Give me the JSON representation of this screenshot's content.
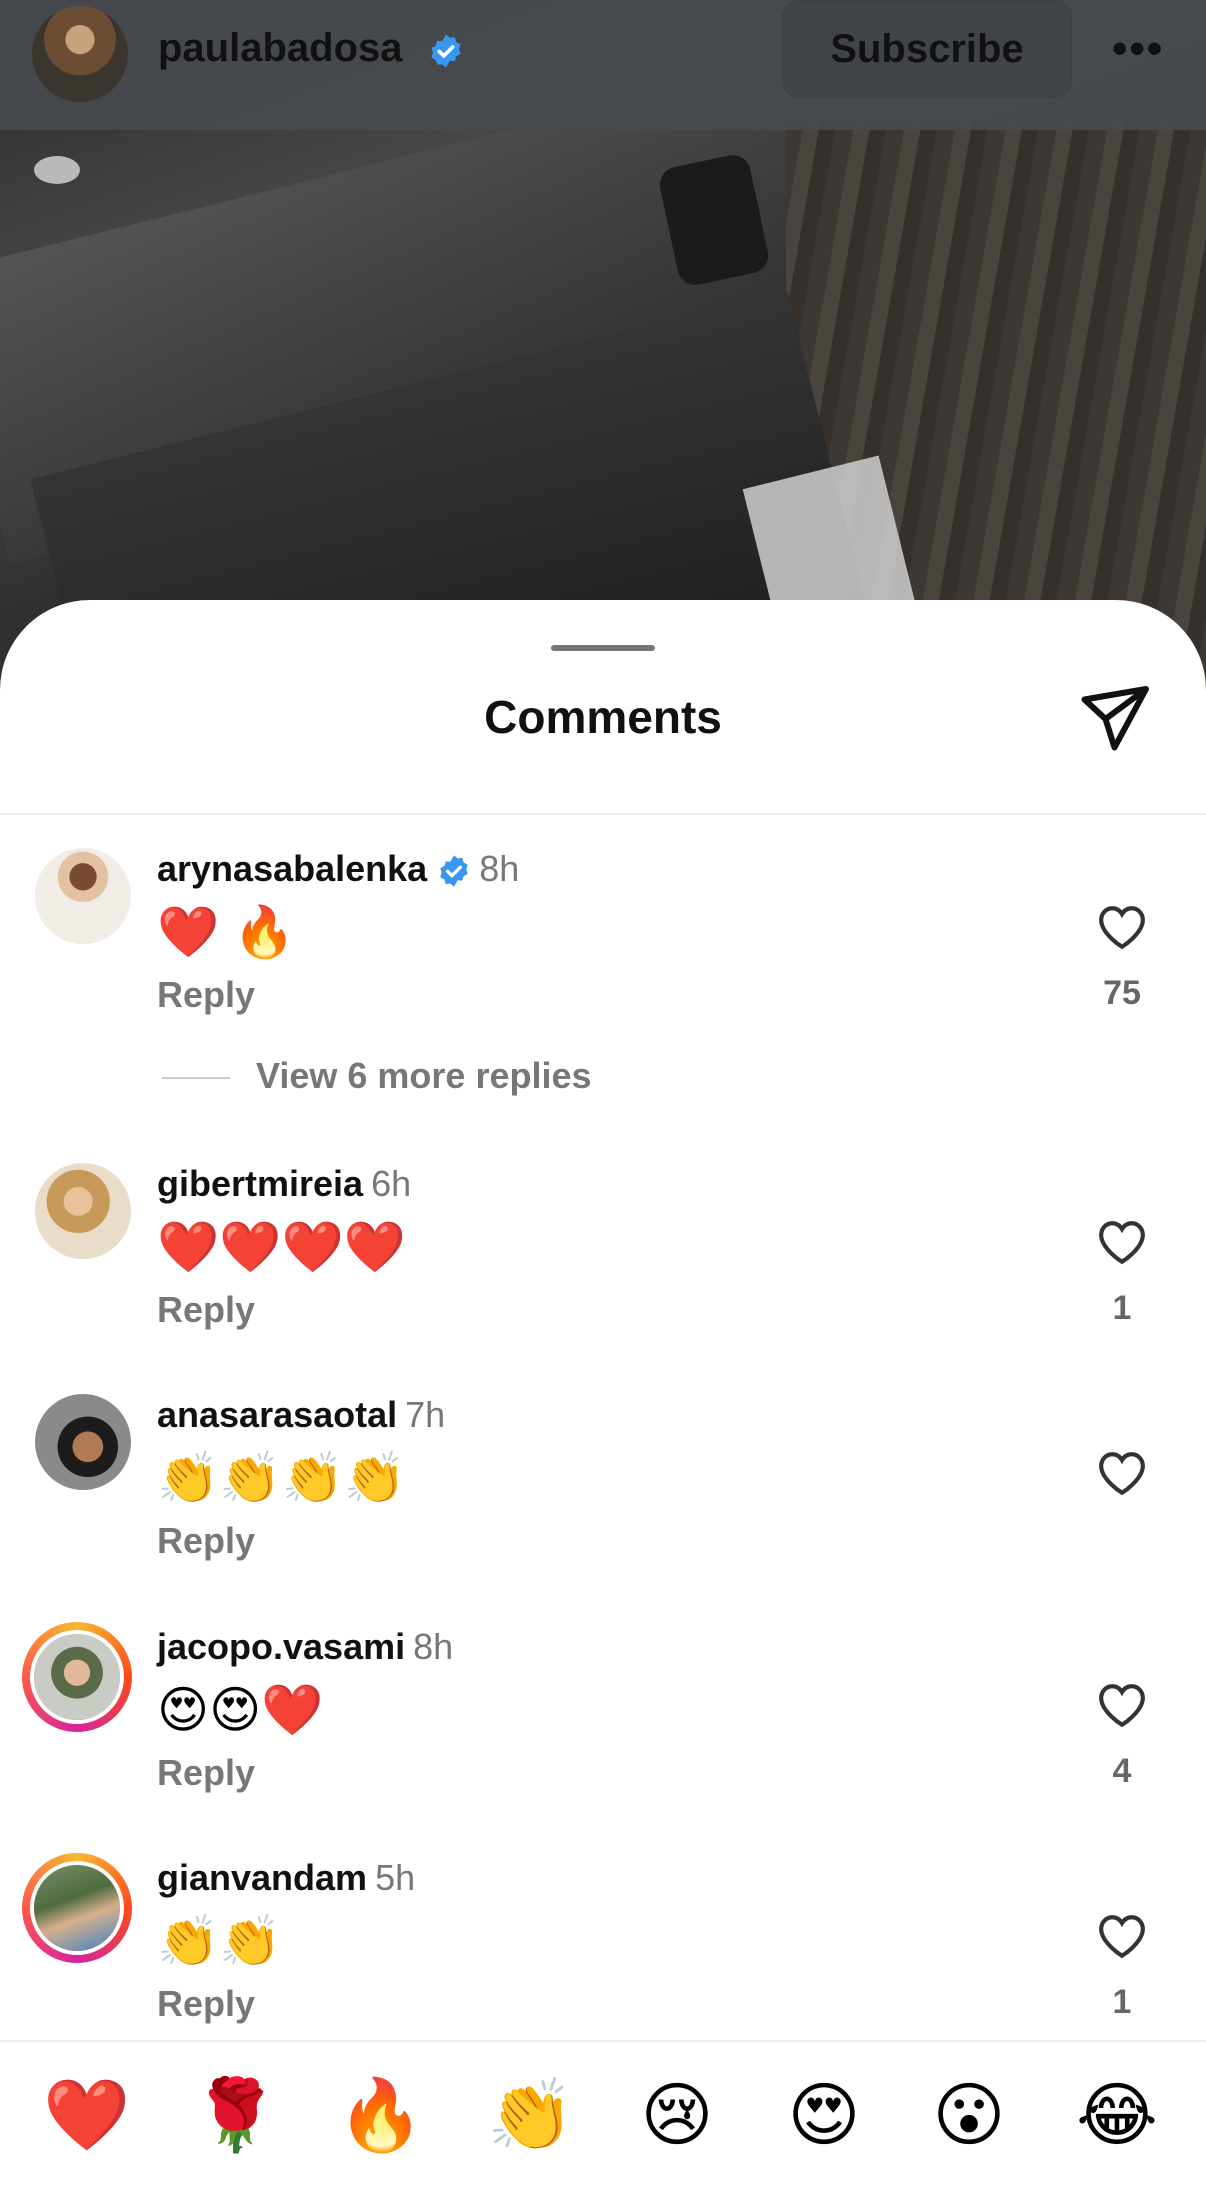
{
  "post": {
    "username": "paulabadosa",
    "subscribe_label": "Subscribe",
    "more_label": "•••"
  },
  "sheet": {
    "title": "Comments"
  },
  "comments": [
    {
      "username": "arynasabalenka",
      "verified": true,
      "time": "8h",
      "text": "❤️ 🔥",
      "reply_label": "Reply",
      "like_count": "75"
    },
    {
      "username": "gibertmireia",
      "verified": false,
      "time": "6h",
      "text": "❤️❤️❤️❤️",
      "reply_label": "Reply",
      "like_count": "1"
    },
    {
      "username": "anasarasaotal",
      "verified": false,
      "time": "7h",
      "text": "👏👏👏👏",
      "reply_label": "Reply",
      "like_count": ""
    },
    {
      "username": "jacopo.vasami",
      "verified": false,
      "time": "8h",
      "text": "😍😍❤️",
      "reply_label": "Reply",
      "like_count": "4"
    },
    {
      "username": "gianvandam",
      "verified": false,
      "time": "5h",
      "text": "👏👏",
      "reply_label": "Reply",
      "like_count": "1"
    }
  ],
  "view_replies_label": "View 6 more replies",
  "emoji_bar": [
    "❤️",
    "🌹",
    "🔥",
    "👏",
    "😢",
    "😍",
    "😮",
    "😂"
  ],
  "colors": {
    "verified": "#3897f0",
    "muted_text": "#777777",
    "story_ring": [
      "#f7b733",
      "#fc4a1a",
      "#d6249f"
    ]
  },
  "icons": {
    "verified": "verified-badge-icon",
    "share": "paper-plane-icon",
    "like": "heart-outline-icon",
    "more": "more-options-icon"
  }
}
